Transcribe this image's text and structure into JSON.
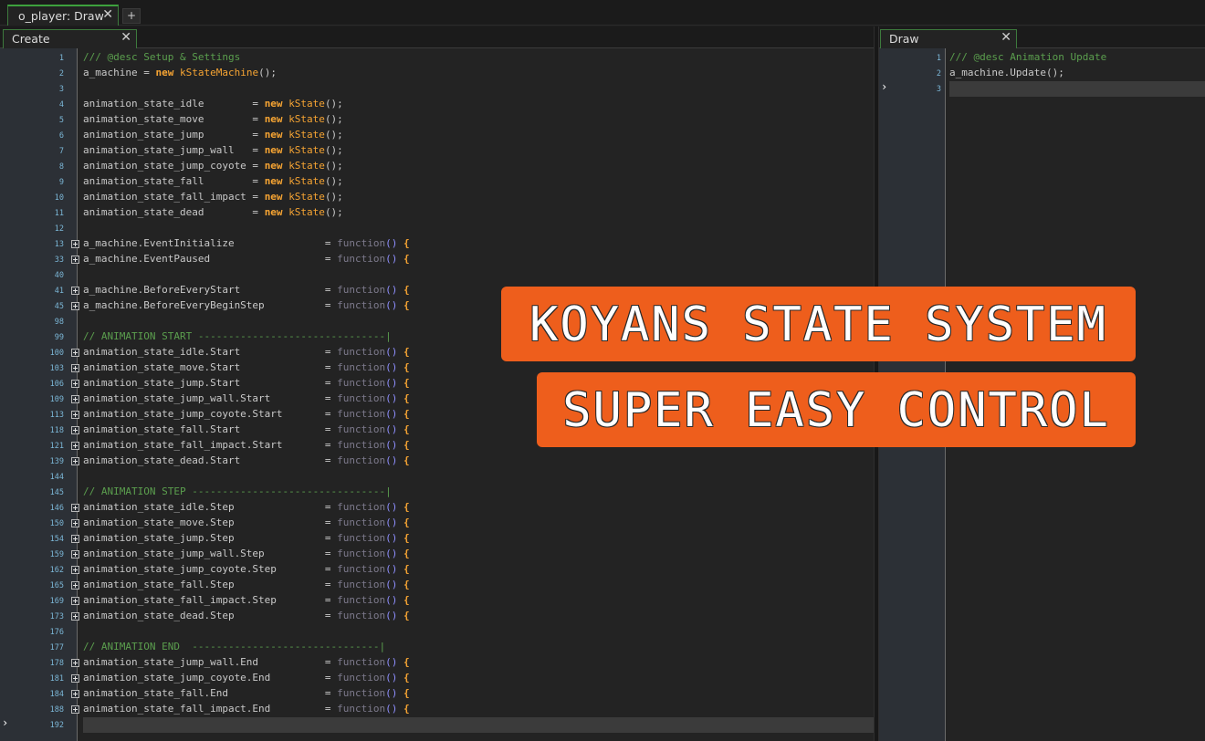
{
  "window": {
    "top_tab": "o_player: Draw",
    "close_glyph": "✕",
    "add_tab_glyph": "+"
  },
  "create_pane": {
    "tab_label": "Create",
    "close_glyph": "✕",
    "lines": [
      {
        "n": "1",
        "fold": false,
        "segs": [
          [
            "com",
            "/// @desc Setup & Settings"
          ]
        ]
      },
      {
        "n": "2",
        "fold": false,
        "segs": [
          [
            "",
            "a_machine = "
          ],
          [
            "kw",
            "new"
          ],
          [
            "",
            " "
          ],
          [
            "cls",
            "kStateMachine"
          ],
          [
            "",
            "();"
          ]
        ]
      },
      {
        "n": "3",
        "fold": false,
        "segs": []
      },
      {
        "n": "4",
        "fold": false,
        "segs": [
          [
            "",
            "animation_state_idle        = "
          ],
          [
            "kw",
            "new"
          ],
          [
            "",
            " "
          ],
          [
            "cls",
            "kState"
          ],
          [
            "",
            "();"
          ]
        ]
      },
      {
        "n": "5",
        "fold": false,
        "segs": [
          [
            "",
            "animation_state_move        = "
          ],
          [
            "kw",
            "new"
          ],
          [
            "",
            " "
          ],
          [
            "cls",
            "kState"
          ],
          [
            "",
            "();"
          ]
        ]
      },
      {
        "n": "6",
        "fold": false,
        "segs": [
          [
            "",
            "animation_state_jump        = "
          ],
          [
            "kw",
            "new"
          ],
          [
            "",
            " "
          ],
          [
            "cls",
            "kState"
          ],
          [
            "",
            "();"
          ]
        ]
      },
      {
        "n": "7",
        "fold": false,
        "segs": [
          [
            "",
            "animation_state_jump_wall   = "
          ],
          [
            "kw",
            "new"
          ],
          [
            "",
            " "
          ],
          [
            "cls",
            "kState"
          ],
          [
            "",
            "();"
          ]
        ]
      },
      {
        "n": "8",
        "fold": false,
        "segs": [
          [
            "",
            "animation_state_jump_coyote = "
          ],
          [
            "kw",
            "new"
          ],
          [
            "",
            " "
          ],
          [
            "cls",
            "kState"
          ],
          [
            "",
            "();"
          ]
        ]
      },
      {
        "n": "9",
        "fold": false,
        "segs": [
          [
            "",
            "animation_state_fall        = "
          ],
          [
            "kw",
            "new"
          ],
          [
            "",
            " "
          ],
          [
            "cls",
            "kState"
          ],
          [
            "",
            "();"
          ]
        ]
      },
      {
        "n": "10",
        "fold": false,
        "segs": [
          [
            "",
            "animation_state_fall_impact = "
          ],
          [
            "kw",
            "new"
          ],
          [
            "",
            " "
          ],
          [
            "cls",
            "kState"
          ],
          [
            "",
            "();"
          ]
        ]
      },
      {
        "n": "11",
        "fold": false,
        "segs": [
          [
            "",
            "animation_state_dead        = "
          ],
          [
            "kw",
            "new"
          ],
          [
            "",
            " "
          ],
          [
            "cls",
            "kState"
          ],
          [
            "",
            "();"
          ]
        ]
      },
      {
        "n": "12",
        "fold": false,
        "segs": []
      },
      {
        "n": "13",
        "fold": true,
        "segs": [
          [
            "",
            "a_machine.EventInitialize               = "
          ],
          [
            "fn",
            "function"
          ],
          [
            "pa",
            "()"
          ],
          [
            "",
            " "
          ],
          [
            "br",
            "{"
          ]
        ]
      },
      {
        "n": "33",
        "fold": true,
        "segs": [
          [
            "",
            "a_machine.EventPaused                   = "
          ],
          [
            "fn",
            "function"
          ],
          [
            "pa",
            "()"
          ],
          [
            "",
            " "
          ],
          [
            "br",
            "{"
          ]
        ]
      },
      {
        "n": "40",
        "fold": false,
        "segs": []
      },
      {
        "n": "41",
        "fold": true,
        "segs": [
          [
            "",
            "a_machine.BeforeEveryStart              = "
          ],
          [
            "fn",
            "function"
          ],
          [
            "pa",
            "()"
          ],
          [
            "",
            " "
          ],
          [
            "br",
            "{"
          ]
        ]
      },
      {
        "n": "45",
        "fold": true,
        "segs": [
          [
            "",
            "a_machine.BeforeEveryBeginStep          = "
          ],
          [
            "fn",
            "function"
          ],
          [
            "pa",
            "()"
          ],
          [
            "",
            " "
          ],
          [
            "br",
            "{"
          ]
        ]
      },
      {
        "n": "98",
        "fold": false,
        "segs": []
      },
      {
        "n": "99",
        "fold": false,
        "segs": [
          [
            "com",
            "// ANIMATION START -------------------------------|"
          ]
        ]
      },
      {
        "n": "100",
        "fold": true,
        "segs": [
          [
            "",
            "animation_state_idle.Start              = "
          ],
          [
            "fn",
            "function"
          ],
          [
            "pa",
            "()"
          ],
          [
            "",
            " "
          ],
          [
            "br",
            "{"
          ]
        ]
      },
      {
        "n": "103",
        "fold": true,
        "segs": [
          [
            "",
            "animation_state_move.Start              = "
          ],
          [
            "fn",
            "function"
          ],
          [
            "pa",
            "()"
          ],
          [
            "",
            " "
          ],
          [
            "br",
            "{"
          ]
        ]
      },
      {
        "n": "106",
        "fold": true,
        "segs": [
          [
            "",
            "animation_state_jump.Start              = "
          ],
          [
            "fn",
            "function"
          ],
          [
            "pa",
            "()"
          ],
          [
            "",
            " "
          ],
          [
            "br",
            "{"
          ]
        ]
      },
      {
        "n": "109",
        "fold": true,
        "segs": [
          [
            "",
            "animation_state_jump_wall.Start         = "
          ],
          [
            "fn",
            "function"
          ],
          [
            "pa",
            "()"
          ],
          [
            "",
            " "
          ],
          [
            "br",
            "{"
          ]
        ]
      },
      {
        "n": "113",
        "fold": true,
        "segs": [
          [
            "",
            "animation_state_jump_coyote.Start       = "
          ],
          [
            "fn",
            "function"
          ],
          [
            "pa",
            "()"
          ],
          [
            "",
            " "
          ],
          [
            "br",
            "{"
          ]
        ]
      },
      {
        "n": "118",
        "fold": true,
        "segs": [
          [
            "",
            "animation_state_fall.Start              = "
          ],
          [
            "fn",
            "function"
          ],
          [
            "pa",
            "()"
          ],
          [
            "",
            " "
          ],
          [
            "br",
            "{"
          ]
        ]
      },
      {
        "n": "121",
        "fold": true,
        "segs": [
          [
            "",
            "animation_state_fall_impact.Start       = "
          ],
          [
            "fn",
            "function"
          ],
          [
            "pa",
            "()"
          ],
          [
            "",
            " "
          ],
          [
            "br",
            "{"
          ]
        ]
      },
      {
        "n": "139",
        "fold": true,
        "segs": [
          [
            "",
            "animation_state_dead.Start              = "
          ],
          [
            "fn",
            "function"
          ],
          [
            "pa",
            "()"
          ],
          [
            "",
            " "
          ],
          [
            "br",
            "{"
          ]
        ]
      },
      {
        "n": "144",
        "fold": false,
        "segs": []
      },
      {
        "n": "145",
        "fold": false,
        "segs": [
          [
            "com",
            "// ANIMATION STEP --------------------------------|"
          ]
        ]
      },
      {
        "n": "146",
        "fold": true,
        "segs": [
          [
            "",
            "animation_state_idle.Step               = "
          ],
          [
            "fn",
            "function"
          ],
          [
            "pa",
            "()"
          ],
          [
            "",
            " "
          ],
          [
            "br",
            "{"
          ]
        ]
      },
      {
        "n": "150",
        "fold": true,
        "segs": [
          [
            "",
            "animation_state_move.Step               = "
          ],
          [
            "fn",
            "function"
          ],
          [
            "pa",
            "()"
          ],
          [
            "",
            " "
          ],
          [
            "br",
            "{"
          ]
        ]
      },
      {
        "n": "154",
        "fold": true,
        "segs": [
          [
            "",
            "animation_state_jump.Step               = "
          ],
          [
            "fn",
            "function"
          ],
          [
            "pa",
            "()"
          ],
          [
            "",
            " "
          ],
          [
            "br",
            "{"
          ]
        ]
      },
      {
        "n": "159",
        "fold": true,
        "segs": [
          [
            "",
            "animation_state_jump_wall.Step          = "
          ],
          [
            "fn",
            "function"
          ],
          [
            "pa",
            "()"
          ],
          [
            "",
            " "
          ],
          [
            "br",
            "{"
          ]
        ]
      },
      {
        "n": "162",
        "fold": true,
        "segs": [
          [
            "",
            "animation_state_jump_coyote.Step        = "
          ],
          [
            "fn",
            "function"
          ],
          [
            "pa",
            "()"
          ],
          [
            "",
            " "
          ],
          [
            "br",
            "{"
          ]
        ]
      },
      {
        "n": "165",
        "fold": true,
        "segs": [
          [
            "",
            "animation_state_fall.Step               = "
          ],
          [
            "fn",
            "function"
          ],
          [
            "pa",
            "()"
          ],
          [
            "",
            " "
          ],
          [
            "br",
            "{"
          ]
        ]
      },
      {
        "n": "169",
        "fold": true,
        "segs": [
          [
            "",
            "animation_state_fall_impact.Step        = "
          ],
          [
            "fn",
            "function"
          ],
          [
            "pa",
            "()"
          ],
          [
            "",
            " "
          ],
          [
            "br",
            "{"
          ]
        ]
      },
      {
        "n": "173",
        "fold": true,
        "segs": [
          [
            "",
            "animation_state_dead.Step               = "
          ],
          [
            "fn",
            "function"
          ],
          [
            "pa",
            "()"
          ],
          [
            "",
            " "
          ],
          [
            "br",
            "{"
          ]
        ]
      },
      {
        "n": "176",
        "fold": false,
        "segs": []
      },
      {
        "n": "177",
        "fold": false,
        "segs": [
          [
            "com",
            "// ANIMATION END  -------------------------------|"
          ]
        ]
      },
      {
        "n": "178",
        "fold": true,
        "segs": [
          [
            "",
            "animation_state_jump_wall.End           = "
          ],
          [
            "fn",
            "function"
          ],
          [
            "pa",
            "()"
          ],
          [
            "",
            " "
          ],
          [
            "br",
            "{"
          ]
        ]
      },
      {
        "n": "181",
        "fold": true,
        "segs": [
          [
            "",
            "animation_state_jump_coyote.End         = "
          ],
          [
            "fn",
            "function"
          ],
          [
            "pa",
            "()"
          ],
          [
            "",
            " "
          ],
          [
            "br",
            "{"
          ]
        ]
      },
      {
        "n": "184",
        "fold": true,
        "segs": [
          [
            "",
            "animation_state_fall.End                = "
          ],
          [
            "fn",
            "function"
          ],
          [
            "pa",
            "()"
          ],
          [
            "",
            " "
          ],
          [
            "br",
            "{"
          ]
        ]
      },
      {
        "n": "188",
        "fold": true,
        "segs": [
          [
            "",
            "animation_state_fall_impact.End         = "
          ],
          [
            "fn",
            "function"
          ],
          [
            "pa",
            "()"
          ],
          [
            "",
            " "
          ],
          [
            "br",
            "{"
          ]
        ]
      },
      {
        "n": "192",
        "fold": false,
        "segs": []
      }
    ]
  },
  "draw_pane": {
    "tab_label": "Draw",
    "close_glyph": "✕",
    "lines": [
      {
        "n": "1",
        "fold": false,
        "segs": [
          [
            "com",
            "/// @desc Animation Update"
          ]
        ]
      },
      {
        "n": "2",
        "fold": false,
        "segs": [
          [
            "",
            "a_machine.Update();"
          ]
        ]
      },
      {
        "n": "3",
        "fold": false,
        "segs": []
      }
    ]
  },
  "banners": {
    "title": "KOYANS STATE SYSTEM",
    "subtitle": "SUPER EASY CONTROL",
    "color": "#ee5e1c"
  },
  "icons": {
    "caret": "caret-chevron-icon",
    "fold": "fold-plus-icon"
  }
}
